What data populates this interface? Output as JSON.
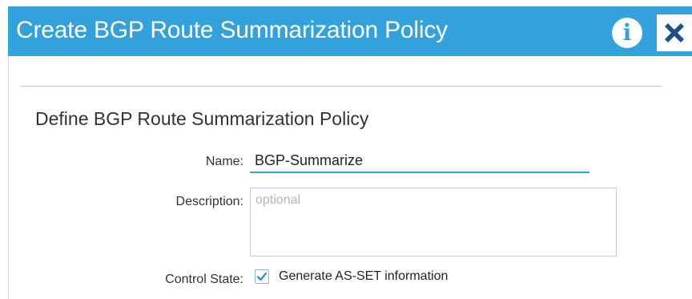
{
  "dialog": {
    "title": "Create BGP Route Summarization Policy",
    "info_icon_glyph": "i",
    "close_icon": "close-icon",
    "accent_color": "#33a1dc"
  },
  "form": {
    "section_title": "Define BGP Route Summarization Policy",
    "name": {
      "label": "Name:",
      "value": "BGP-Summarize"
    },
    "description": {
      "label": "Description:",
      "placeholder": "optional",
      "value": ""
    },
    "control_state": {
      "label": "Control State:",
      "checkbox_label": "Generate AS-SET information",
      "checked": true
    }
  }
}
